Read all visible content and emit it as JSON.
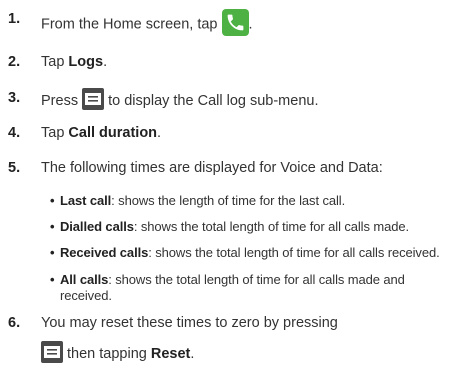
{
  "steps": [
    {
      "number": "1.",
      "pre": "From the Home screen, tap ",
      "post": "."
    },
    {
      "number": "2.",
      "pre": "Tap ",
      "bold": "Logs",
      "post": "."
    },
    {
      "number": "3.",
      "pre": "Press ",
      "post": " to display the Call log sub-menu."
    },
    {
      "number": "4.",
      "pre": "Tap ",
      "bold": "Call duration",
      "post": "."
    },
    {
      "number": "5.",
      "text": "The following times are displayed for Voice and Data:"
    },
    {
      "number": "6.",
      "line1": "You may reset these times to zero by pressing",
      "line2_mid": " then tapping ",
      "line2_bold": "Reset",
      "line2_end": "."
    }
  ],
  "bullets": [
    {
      "term": "Last call",
      "desc": ": shows the length of time for the last call."
    },
    {
      "term": "Dialled calls",
      "desc": ": shows the total length of time for all calls made."
    },
    {
      "term": "Received calls",
      "desc": ": shows the total length of time for all calls received."
    },
    {
      "term": "All calls",
      "desc": ": shows the total length of time for all calls made and",
      "desc2": "received."
    }
  ],
  "icons": {
    "phone": "phone-icon",
    "menu": "menu-key-icon",
    "phone_color": "#4db144",
    "menu_color": "#4a4a4a"
  }
}
